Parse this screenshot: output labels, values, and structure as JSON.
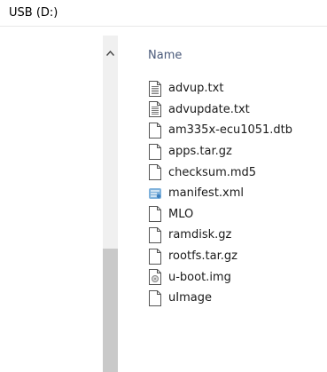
{
  "address": {
    "path": "USB (D:)"
  },
  "columns": {
    "name_label": "Name"
  },
  "files": [
    {
      "name": "advup.txt",
      "icon": "text-file-icon"
    },
    {
      "name": "advupdate.txt",
      "icon": "text-file-icon"
    },
    {
      "name": "am335x-ecu1051.dtb",
      "icon": "blank-file-icon"
    },
    {
      "name": "apps.tar.gz",
      "icon": "blank-file-icon"
    },
    {
      "name": "checksum.md5",
      "icon": "blank-file-icon"
    },
    {
      "name": "manifest.xml",
      "icon": "xml-file-icon"
    },
    {
      "name": "MLO",
      "icon": "blank-file-icon"
    },
    {
      "name": "ramdisk.gz",
      "icon": "blank-file-icon"
    },
    {
      "name": "rootfs.tar.gz",
      "icon": "blank-file-icon"
    },
    {
      "name": "u-boot.img",
      "icon": "image-file-icon"
    },
    {
      "name": "uImage",
      "icon": "blank-file-icon"
    }
  ]
}
